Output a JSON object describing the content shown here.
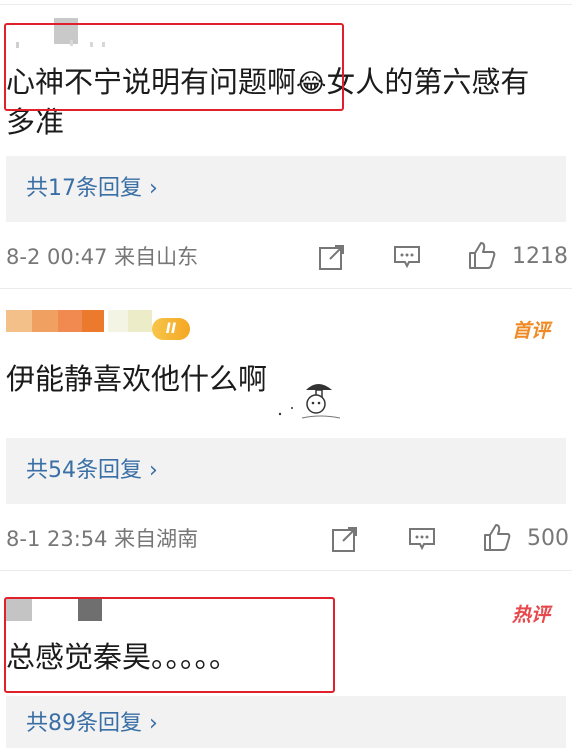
{
  "comments": [
    {
      "content_prefix": "心神不宁说明有问题啊",
      "content_emoji": "😂",
      "content_suffix": "女人的第六感有",
      "content_line2": "多准",
      "reply_label": "共17条回复",
      "reply_arrow": "›",
      "date_source": "8-2 00:47  来自山东",
      "like_count": "1218",
      "highlight_color": "#e0202a"
    },
    {
      "badge": "首评",
      "level": "II",
      "content": "伊能静喜欢他什么啊",
      "reply_label": "共54条回复",
      "reply_arrow": "›",
      "date_source": "8-1 23:54  来自湖南",
      "like_count": "500"
    },
    {
      "badge": "热评",
      "content": "总感觉秦昊。。。。。",
      "reply_label": "共89条回复",
      "reply_arrow": "›"
    }
  ],
  "colors": {
    "link": "#3a6fa6",
    "meta": "#777777",
    "reply_bg": "#f2f2f2",
    "first_comment_badge": "#f08a24",
    "hot_comment_badge": "#e6484c"
  },
  "icons": {
    "share": "share-icon",
    "comment": "comment-icon",
    "like": "thumbs-up-icon"
  }
}
